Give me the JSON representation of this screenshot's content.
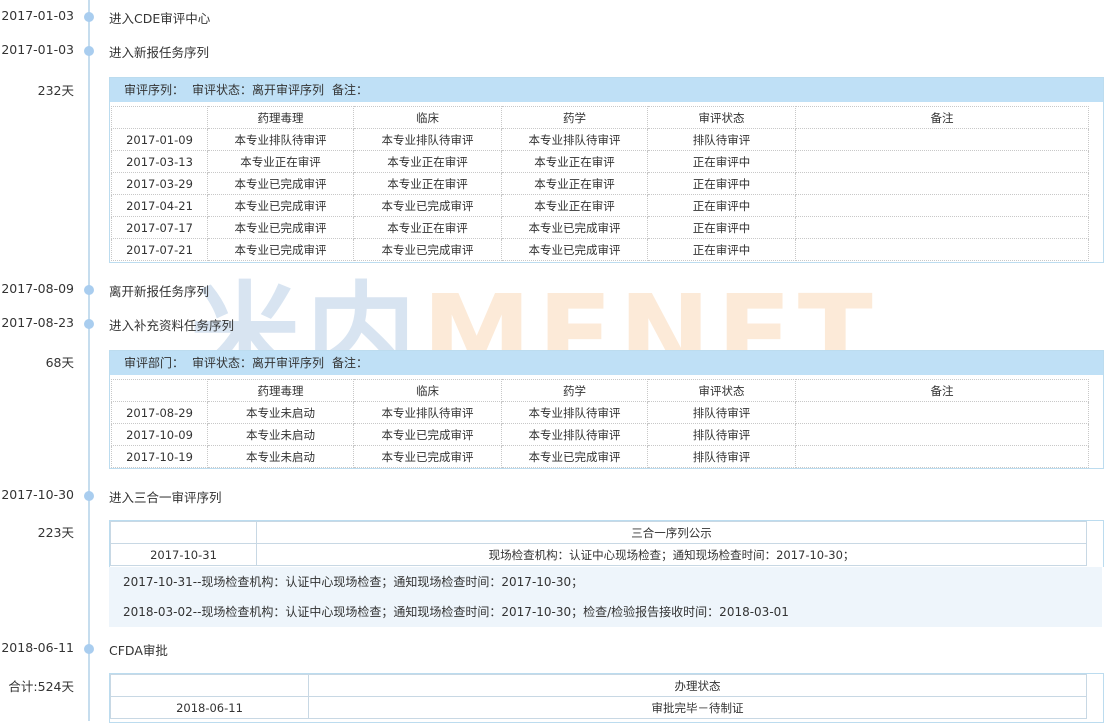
{
  "watermark": {
    "cn": "米内",
    "en": "MENET"
  },
  "events": [
    {
      "date": "2017-01-03",
      "label": "进入CDE审评中心"
    },
    {
      "date": "2017-01-03",
      "label": "进入新报任务序列"
    },
    {
      "date": "2017-08-09",
      "label": "离开新报任务序列"
    },
    {
      "date": "2017-08-23",
      "label": "进入补充资料任务序列"
    },
    {
      "date": "2017-10-30",
      "label": "进入三合一审评序列"
    },
    {
      "date": "2018-06-11",
      "label": "CFDA审批"
    }
  ],
  "durations": [
    "232天",
    "68天",
    "223天",
    "合计:524天"
  ],
  "panel1": {
    "header": [
      "审评序列：",
      "审评状态：离开审评序列",
      "备注："
    ],
    "columns": [
      "",
      "药理毒理",
      "临床",
      "药学",
      "审评状态",
      "备注"
    ],
    "rows": [
      [
        "2017-01-09",
        "本专业排队待审评",
        "本专业排队待审评",
        "本专业排队待审评",
        "排队待审评",
        ""
      ],
      [
        "2017-03-13",
        "本专业正在审评",
        "本专业正在审评",
        "本专业正在审评",
        "正在审评中",
        ""
      ],
      [
        "2017-03-29",
        "本专业已完成审评",
        "本专业正在审评",
        "本专业正在审评",
        "正在审评中",
        ""
      ],
      [
        "2017-04-21",
        "本专业已完成审评",
        "本专业已完成审评",
        "本专业正在审评",
        "正在审评中",
        ""
      ],
      [
        "2017-07-17",
        "本专业已完成审评",
        "本专业正在审评",
        "本专业已完成审评",
        "正在审评中",
        ""
      ],
      [
        "2017-07-21",
        "本专业已完成审评",
        "本专业已完成审评",
        "本专业已完成审评",
        "正在审评中",
        ""
      ]
    ]
  },
  "panel2": {
    "header": [
      "审评部门：",
      "审评状态：离开审评序列",
      "备注："
    ],
    "columns": [
      "",
      "药理毒理",
      "临床",
      "药学",
      "审评状态",
      "备注"
    ],
    "rows": [
      [
        "2017-08-29",
        "本专业未启动",
        "本专业排队待审评",
        "本专业排队待审评",
        "排队待审评",
        ""
      ],
      [
        "2017-10-09",
        "本专业未启动",
        "本专业已完成审评",
        "本专业排队待审评",
        "排队待审评",
        ""
      ],
      [
        "2017-10-19",
        "本专业未启动",
        "本专业已完成审评",
        "本专业已完成审评",
        "排队待审评",
        ""
      ]
    ]
  },
  "panel3": {
    "title": "三合一序列公示",
    "row_date": "2017-10-31",
    "row_text": "现场检查机构：认证中心现场检查；通知现场检查时间：2017-10-30；",
    "notes": [
      "2017-10-31--现场检查机构：认证中心现场检查；通知现场检查时间：2017-10-30；",
      "2018-03-02--现场检查机构：认证中心现场检查；通知现场检查时间：2017-10-30；检查/检验报告接收时间：2018-03-01"
    ]
  },
  "panel4": {
    "title": "办理状态",
    "row_date": "2018-06-11",
    "row_text": "审批完毕－待制证"
  }
}
